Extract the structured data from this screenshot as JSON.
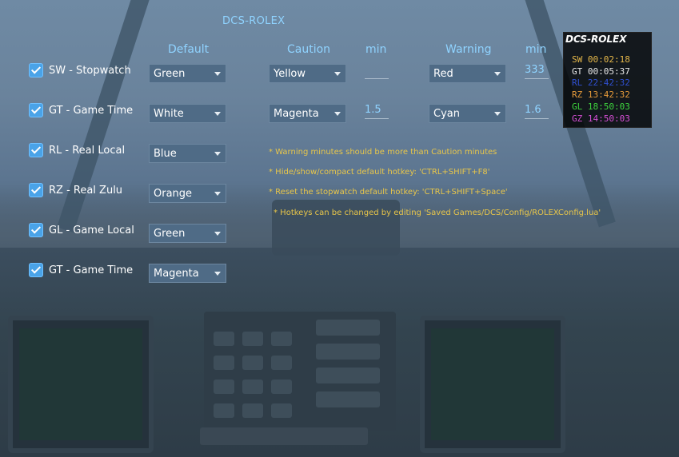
{
  "app_title": "DCS-ROLEX",
  "headers": {
    "default": "Default",
    "caution": "Caution",
    "caution_min": "min",
    "warning": "Warning",
    "warning_min": "min"
  },
  "rows": [
    {
      "label": "SW - Stopwatch",
      "checked": true,
      "default": "Green",
      "caution": "Yellow",
      "caution_min": "",
      "warning": "Red",
      "warning_min": "333"
    },
    {
      "label": "GT - Game Time",
      "checked": true,
      "default": "White",
      "caution": "Magenta",
      "caution_min": "1.5",
      "warning": "Cyan",
      "warning_min": "1.6"
    },
    {
      "label": "RL - Real Local",
      "checked": true,
      "default": "Blue"
    },
    {
      "label": "RZ - Real Zulu",
      "checked": true,
      "default": "Orange"
    },
    {
      "label": "GL - Game Local",
      "checked": true,
      "default": "Green"
    },
    {
      "label": "GT - Game Time",
      "checked": true,
      "default": "Magenta"
    }
  ],
  "notes": [
    "* Warning minutes should be more than Caution minutes",
    "* Hide/show/compact default hotkey: 'CTRL+SHIFT+F8'",
    "* Reset the stopwatch default hotkey: 'CTRL+SHIFT+Space'",
    "* Hotkeys can be changed by editing 'Saved Games/DCS/Config/ROLEXConfig.lua'"
  ],
  "clock": {
    "title": "DCS-ROLEX",
    "rows": [
      {
        "text": "SW 00:02:18",
        "color": "#e6b84a"
      },
      {
        "text": "GT 00:05:37",
        "color": "#e8e8e8"
      },
      {
        "text": "RL 22:42:32",
        "color": "#2f4fd0"
      },
      {
        "text": "RZ 13:42:32",
        "color": "#e59a3a"
      },
      {
        "text": "GL 18:50:03",
        "color": "#3ed63e"
      },
      {
        "text": "GZ 14:50:03",
        "color": "#d64fd6"
      }
    ]
  }
}
